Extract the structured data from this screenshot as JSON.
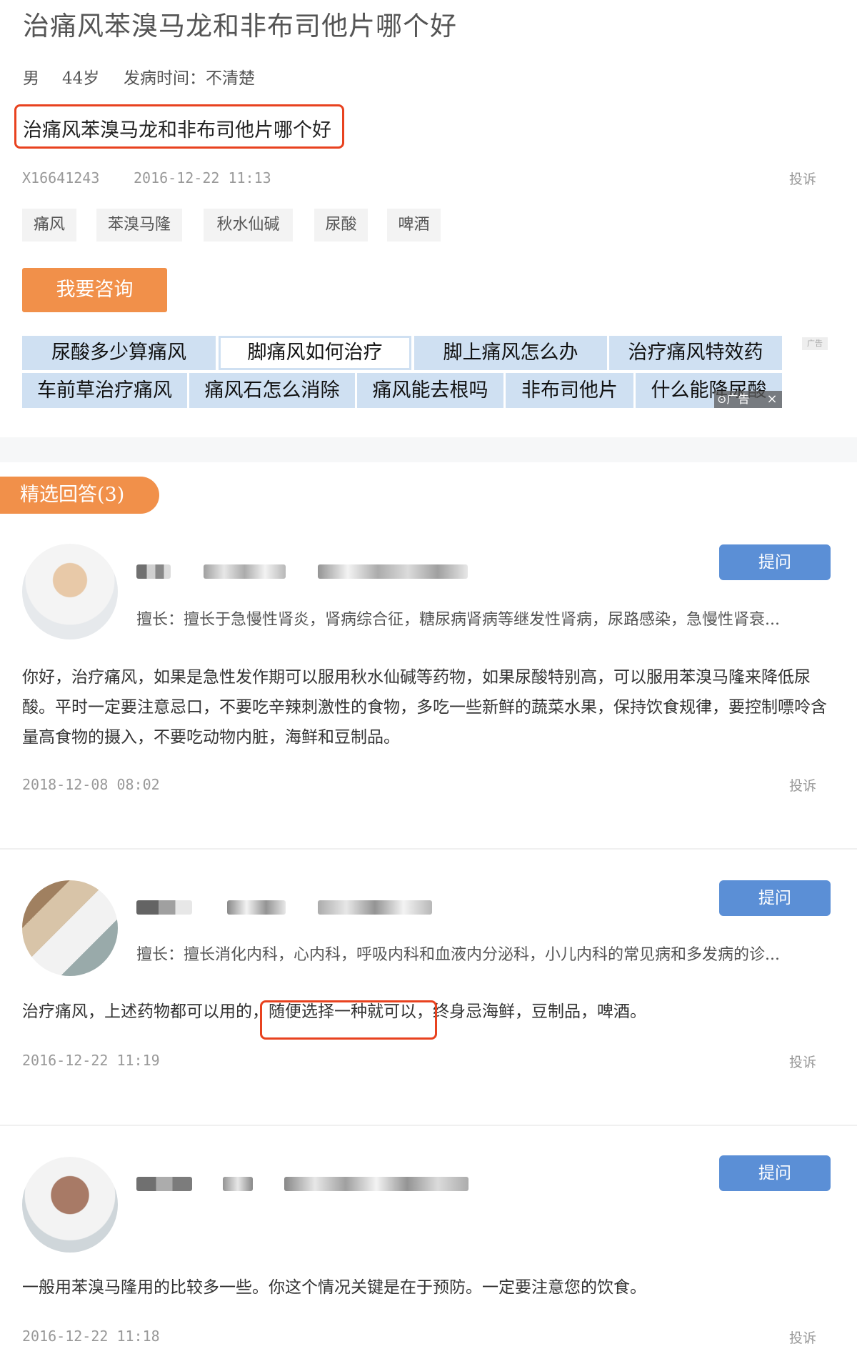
{
  "question": {
    "title": "治痛风苯溴马龙和非布司他片哪个好",
    "gender": "男",
    "age": "44岁",
    "onset": "发病时间：不清楚",
    "text": "治痛风苯溴马龙和非布司他片哪个好",
    "user_id": "X16641243",
    "time": "2016-12-22 11:13",
    "complain": "投诉"
  },
  "tags": [
    "痛风",
    "苯溴马隆",
    "秋水仙碱",
    "尿酸",
    "啤酒"
  ],
  "consult_button": "我要咨询",
  "ad_links": {
    "row1": [
      "尿酸多少算痛风",
      "脚痛风如何治疗",
      "脚上痛风怎么办",
      "治疗痛风特效药"
    ],
    "row2": [
      "车前草治疗痛风",
      "痛风石怎么消除",
      "痛风能去根吗",
      "非布司他片",
      "什么能降尿酸"
    ],
    "ad_tag": "广告",
    "ad_mark": "⊙广告",
    "ad_close": "×"
  },
  "answers_header": "精选回答(3)",
  "answers": [
    {
      "ask_label": "提问",
      "specialty": "擅长：擅长于急慢性肾炎，肾病综合征，糖尿病肾病等继发性肾病，尿路感染，急慢性肾衰...",
      "text": "你好，治疗痛风，如果是急性发作期可以服用秋水仙碱等药物，如果尿酸特别高，可以服用苯溴马隆来降低尿酸。平时一定要注意忌口，不要吃辛辣刺激性的食物，多吃一些新鲜的蔬菜水果，保持饮食规律，要控制嘌呤含量高食物的摄入，不要吃动物内脏，海鲜和豆制品。",
      "date": "2018-12-08 08:02",
      "complain": "投诉"
    },
    {
      "ask_label": "提问",
      "specialty": "擅长：擅长消化内科，心内科，呼吸内科和血液内分泌科，小儿内科的常见病和多发病的诊...",
      "text_a": "治疗痛风，上述药物都可以用的，",
      "text_b": "随便选择一种就可以，",
      "text_c": "终身忌海鲜，豆制品，啤酒。",
      "date": "2016-12-22 11:19",
      "complain": "投诉"
    },
    {
      "ask_label": "提问",
      "text": "一般用苯溴马隆用的比较多一些。你这个情况关键是在于预防。一定要注意您的饮食。",
      "date": "2016-12-22 11:18",
      "complain": "投诉"
    }
  ],
  "colors": {
    "accent_orange": "#f1904a",
    "link_blue": "#cfe0f2",
    "ask_blue": "#5b8fd6",
    "highlight_red": "#e8421f"
  }
}
